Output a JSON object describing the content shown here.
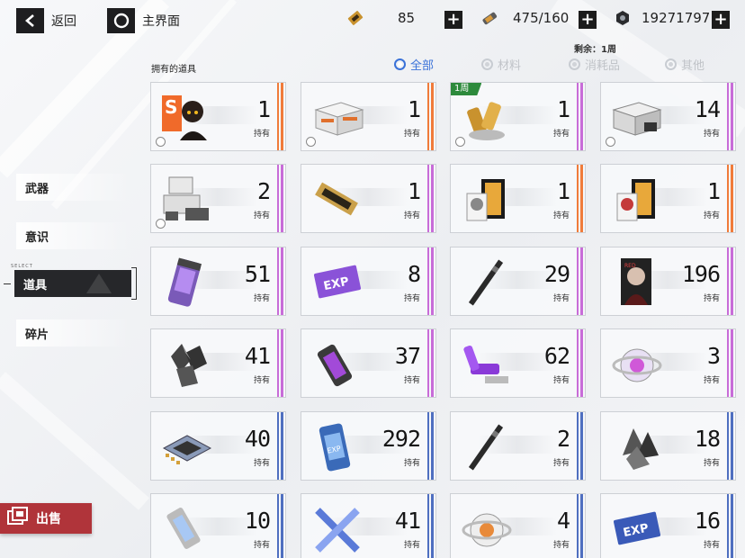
{
  "topbar": {
    "back_label": "返回",
    "home_label": "主界面",
    "resources": [
      {
        "icon": "ticket-icon",
        "value": "85"
      },
      {
        "icon": "stamina-icon",
        "value": "475/160"
      },
      {
        "icon": "coin-icon",
        "value": "19271797"
      }
    ]
  },
  "remaining_label": "剩余：1周",
  "owned_title": "拥有的道具",
  "filters": [
    {
      "label": "全部",
      "active": true
    },
    {
      "label": "材料",
      "active": false
    },
    {
      "label": "消耗品",
      "active": false
    },
    {
      "label": "其他",
      "active": false
    }
  ],
  "menu": {
    "select_tag": "SELECT",
    "items": [
      "武器",
      "意识",
      "道具",
      "碎片"
    ],
    "active": "道具"
  },
  "sell_label": "出售",
  "hold_label": "持有",
  "colors": {
    "orange": "#f07b3a",
    "purple": "#c86cd8",
    "blue": "#4f6fc0",
    "accent": "#3a72d8",
    "sell": "#b0343a"
  },
  "items": [
    {
      "count": "1",
      "rarity": "orange",
      "icon": "s-rank-character-card-icon",
      "selectable": true
    },
    {
      "count": "1",
      "rarity": "orange",
      "icon": "supply-crate-icon",
      "selectable": true
    },
    {
      "count": "1",
      "rarity": "purple",
      "icon": "gold-capsule-icon",
      "selectable": true,
      "tag": "1周"
    },
    {
      "count": "14",
      "rarity": "purple",
      "icon": "metal-crate-icon",
      "selectable": true
    },
    {
      "count": "2",
      "rarity": "purple",
      "icon": "stacked-crates-icon",
      "selectable": true
    },
    {
      "count": "1",
      "rarity": "purple",
      "icon": "gold-ticket-icon",
      "selectable": false
    },
    {
      "count": "1",
      "rarity": "orange",
      "icon": "gold-box-character-icon",
      "selectable": false
    },
    {
      "count": "1",
      "rarity": "orange",
      "icon": "gold-box-character-red-icon",
      "selectable": false
    },
    {
      "count": "51",
      "rarity": "purple",
      "icon": "purple-canister-icon",
      "selectable": false
    },
    {
      "count": "8",
      "rarity": "purple",
      "icon": "purple-exp-card-icon",
      "selectable": false
    },
    {
      "count": "29",
      "rarity": "purple",
      "icon": "black-rod-icon",
      "selectable": false
    },
    {
      "count": "196",
      "rarity": "purple",
      "icon": "portrait-card-icon",
      "selectable": false
    },
    {
      "count": "41",
      "rarity": "purple",
      "icon": "dark-crystal-icon",
      "selectable": false
    },
    {
      "count": "37",
      "rarity": "purple",
      "icon": "purple-vial-icon",
      "selectable": false
    },
    {
      "count": "62",
      "rarity": "purple",
      "icon": "purple-battery-icon",
      "selectable": false
    },
    {
      "count": "3",
      "rarity": "purple",
      "icon": "purple-orb-icon",
      "selectable": false
    },
    {
      "count": "40",
      "rarity": "blue",
      "icon": "chip-icon",
      "selectable": false
    },
    {
      "count": "292",
      "rarity": "blue",
      "icon": "blue-exp-canister-icon",
      "selectable": false
    },
    {
      "count": "2",
      "rarity": "blue",
      "icon": "black-rod-icon",
      "selectable": false
    },
    {
      "count": "18",
      "rarity": "blue",
      "icon": "grey-crystal-icon",
      "selectable": false
    },
    {
      "count": "10",
      "rarity": "blue",
      "icon": "blue-vial-icon",
      "selectable": false
    },
    {
      "count": "41",
      "rarity": "blue",
      "icon": "blue-ribbon-icon",
      "selectable": false
    },
    {
      "count": "4",
      "rarity": "blue",
      "icon": "orange-orb-icon",
      "selectable": false
    },
    {
      "count": "16",
      "rarity": "blue",
      "icon": "blue-exp-card-icon",
      "selectable": false
    }
  ]
}
